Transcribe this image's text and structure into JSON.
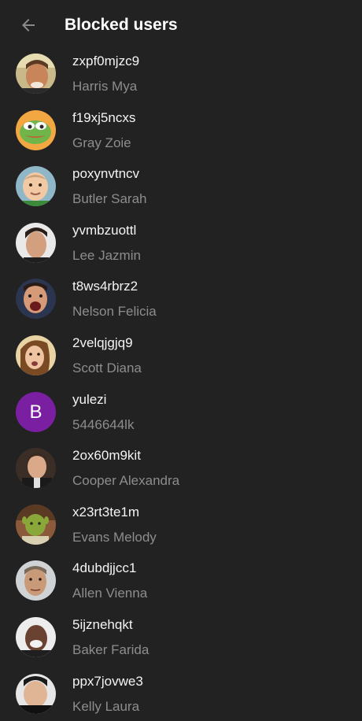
{
  "header": {
    "title": "Blocked users",
    "back_icon": "arrow-left-icon"
  },
  "users": [
    {
      "username": "zxpf0mjzc9",
      "name": "Harris Mya",
      "avatar": "photo-man-smiling"
    },
    {
      "username": "f19xj5ncxs",
      "name": "Gray Zoie",
      "avatar": "photo-frog-cartoon"
    },
    {
      "username": "poxynvtncv",
      "name": "Butler Sarah",
      "avatar": "photo-baby"
    },
    {
      "username": "yvmbzuottl",
      "name": "Lee Jazmin",
      "avatar": "photo-man-dark-hair"
    },
    {
      "username": "t8ws4rbrz2",
      "name": "Nelson Felicia",
      "avatar": "photo-man-shouting"
    },
    {
      "username": "2velqjgjq9",
      "name": "Scott Diana",
      "avatar": "photo-woman-surprised"
    },
    {
      "username": "yulezi",
      "name": "5446644lk",
      "avatar": "letter-avatar",
      "avatar_letter": "B",
      "avatar_color": "#7b1fa2"
    },
    {
      "username": "2ox60m9kit",
      "name": "Cooper Alexandra",
      "avatar": "photo-man-suit"
    },
    {
      "username": "x23rt3te1m",
      "name": "Evans Melody",
      "avatar": "photo-green-ogre"
    },
    {
      "username": "4dubdjjcc1",
      "name": "Allen Vienna",
      "avatar": "photo-man-older"
    },
    {
      "username": "5ijznehqkt",
      "name": "Baker Farida",
      "avatar": "photo-man-laughing"
    },
    {
      "username": "ppx7jovwe3",
      "name": "Kelly Laura",
      "avatar": "photo-man-black-suit"
    }
  ],
  "colors": {
    "background": "#222222",
    "primary_text": "#f4f4f4",
    "secondary_text": "#8d8d8d"
  }
}
